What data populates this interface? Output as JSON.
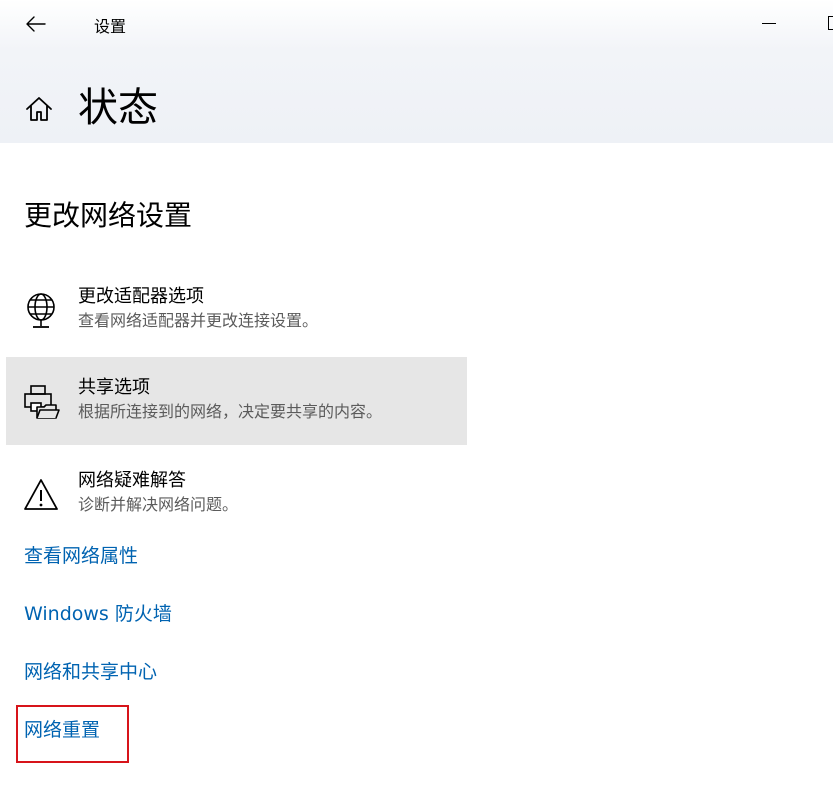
{
  "window": {
    "title": "设置",
    "back_icon": "arrow-left",
    "minimize_icon": "minimize"
  },
  "page": {
    "home_icon": "home",
    "title": "状态"
  },
  "section": {
    "title": "更改网络设置"
  },
  "options": [
    {
      "icon": "globe-monitor",
      "title": "更改适配器选项",
      "description": "查看网络适配器并更改连接设置。"
    },
    {
      "icon": "printer-folder",
      "title": "共享选项",
      "description": "根据所连接到的网络，决定要共享的内容。",
      "state": "hover"
    },
    {
      "icon": "warning-triangle",
      "title": "网络疑难解答",
      "description": "诊断并解决网络问题。"
    }
  ],
  "links": [
    "查看网络属性",
    "Windows 防火墙",
    "网络和共享中心",
    "网络重置"
  ],
  "colors": {
    "link": "#0063b1",
    "hover_background": "#e6e6e6",
    "highlight_border": "#d7141a",
    "description_text": "#5b5b5b"
  }
}
